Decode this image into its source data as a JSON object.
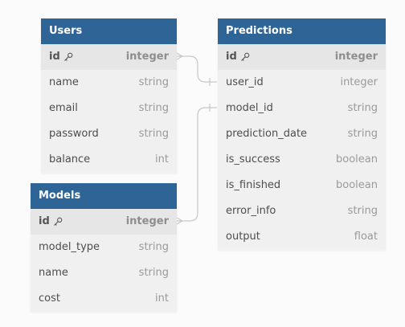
{
  "colors": {
    "header_bg": "#2e6596",
    "header_text": "#ffffff",
    "row_bg": "#f0f0f0",
    "pk_row_bg": "#e6e6e6",
    "connector": "#c8c8c8"
  },
  "tables": {
    "users": {
      "title": "Users",
      "fields": [
        {
          "name": "id",
          "type": "integer",
          "pk": true
        },
        {
          "name": "name",
          "type": "string"
        },
        {
          "name": "email",
          "type": "string"
        },
        {
          "name": "password",
          "type": "string"
        },
        {
          "name": "balance",
          "type": "int"
        }
      ]
    },
    "models": {
      "title": "Models",
      "fields": [
        {
          "name": "id",
          "type": "integer",
          "pk": true
        },
        {
          "name": "model_type",
          "type": "string"
        },
        {
          "name": "name",
          "type": "string"
        },
        {
          "name": "cost",
          "type": "int"
        }
      ]
    },
    "predictions": {
      "title": "Predictions",
      "fields": [
        {
          "name": "id",
          "type": "integer",
          "pk": true
        },
        {
          "name": "user_id",
          "type": "integer"
        },
        {
          "name": "model_id",
          "type": "string"
        },
        {
          "name": "prediction_date",
          "type": "string"
        },
        {
          "name": "is_success",
          "type": "boolean"
        },
        {
          "name": "is_finished",
          "type": "boolean"
        },
        {
          "name": "error_info",
          "type": "string"
        },
        {
          "name": "output",
          "type": "float"
        }
      ]
    }
  },
  "relationships": [
    {
      "from": "users.id",
      "to": "predictions.user_id"
    },
    {
      "from": "models.id",
      "to": "predictions.model_id"
    }
  ]
}
